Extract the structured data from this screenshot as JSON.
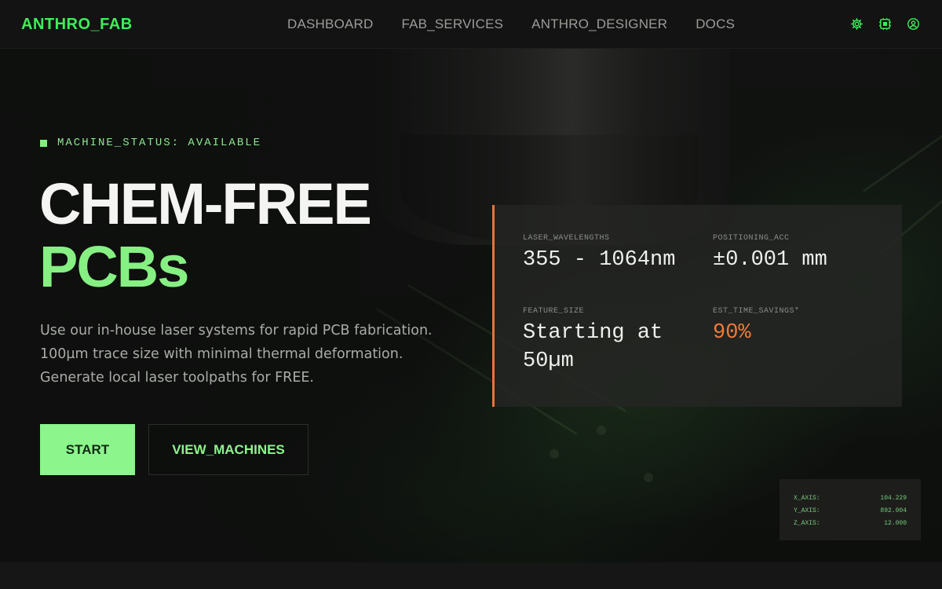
{
  "brand": {
    "name": "ANTHRO_FAB"
  },
  "nav": {
    "links": [
      {
        "label": "DASHBOARD"
      },
      {
        "label": "FAB_SERVICES"
      },
      {
        "label": "ANTHRO_DESIGNER"
      },
      {
        "label": "DOCS"
      }
    ],
    "icons": [
      "settings-icon",
      "memory-chip-icon",
      "account-circle-icon"
    ]
  },
  "hero": {
    "status": "MACHINE_STATUS: AVAILABLE",
    "headline_line1": "CHEM-FREE",
    "headline_line2": "PCBs",
    "description_lines": [
      "Use our in-house laser systems for rapid PCB fabrication.",
      "100µm trace size with minimal thermal deformation.",
      "Generate local laser toolpaths for FREE."
    ],
    "primary_button": "START",
    "secondary_button": "VIEW_MACHINES"
  },
  "specs": [
    {
      "label": "LASER_WAVELENGTHS",
      "value": "355 - 1064nm"
    },
    {
      "label": "POSITIONING_ACC",
      "value": "±0.001 mm"
    },
    {
      "label": "FEATURE_SIZE",
      "value": "Starting at 50µm"
    },
    {
      "label": "EST_TIME_SAVINGS*",
      "value": "90%"
    }
  ],
  "axes": [
    {
      "label": "X_AXIS:",
      "value": "104.229"
    },
    {
      "label": "Y_AXIS:",
      "value": "892.004"
    },
    {
      "label": "Z_AXIS:",
      "value": "12.000"
    }
  ],
  "colors": {
    "brand_green": "#3cf05a",
    "accent_green": "#8cf58c",
    "accent_orange": "#ef7a3c",
    "background": "#0e0f0e"
  }
}
